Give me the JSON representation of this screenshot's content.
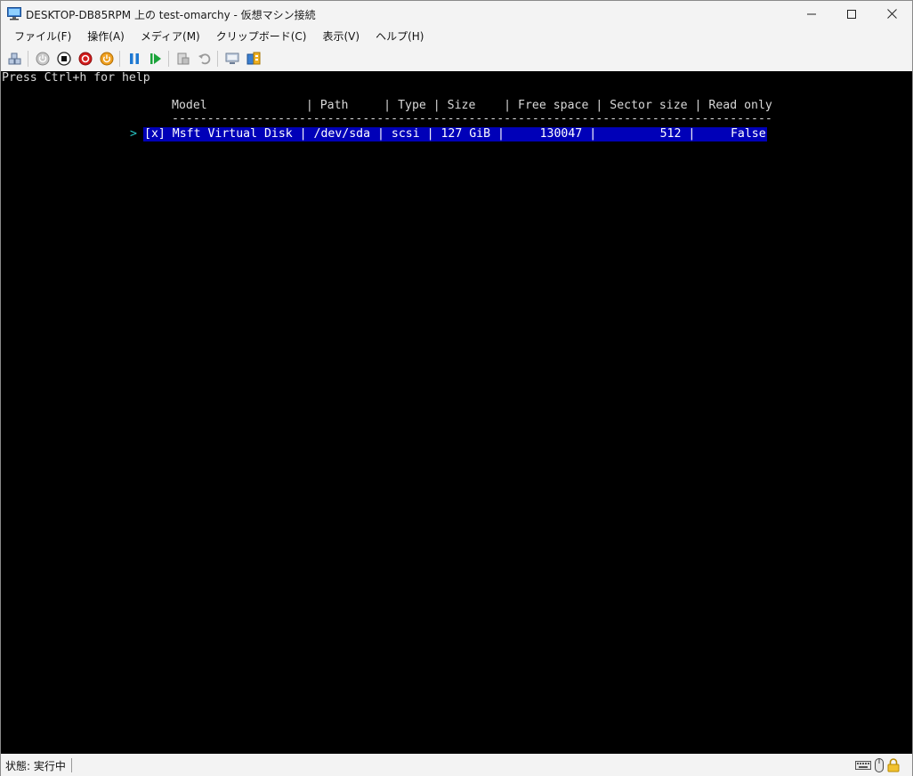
{
  "window": {
    "title": "DESKTOP-DB85RPM 上の test-omarchy - 仮想マシン接続",
    "minimize_glyph": "—",
    "maximize_glyph": "☐",
    "close_glyph": "✕"
  },
  "menu": {
    "items": [
      {
        "label": "ファイル(F)"
      },
      {
        "label": "操作(A)"
      },
      {
        "label": "メディア(M)"
      },
      {
        "label": "クリップボード(C)"
      },
      {
        "label": "表示(V)"
      },
      {
        "label": "ヘルプ(H)"
      }
    ]
  },
  "toolbar": {
    "icons": [
      "ctrl-alt-del-icon",
      "start-icon",
      "turn-off-icon",
      "shutdown-icon",
      "save-state-icon",
      "pause-icon",
      "resume-icon",
      "checkpoint-icon",
      "revert-icon",
      "enhanced-session-icon",
      "share-icon"
    ]
  },
  "console": {
    "help": "Press Ctrl+h for help",
    "header": "Model              | Path     | Type | Size    | Free space | Sector size | Read only",
    "divider": "-------------------------------------------------------------------------------------",
    "cursor": ">",
    "row": "[x] Msft Virtual Disk | /dev/sda | scsi | 127 GiB |     130047 |         512 |     False"
  },
  "status": {
    "text": "状態: 実行中"
  },
  "colors": {
    "console_bg": "#000000",
    "selection_bg": "#0000b8",
    "cursor": "#28c7c7"
  }
}
